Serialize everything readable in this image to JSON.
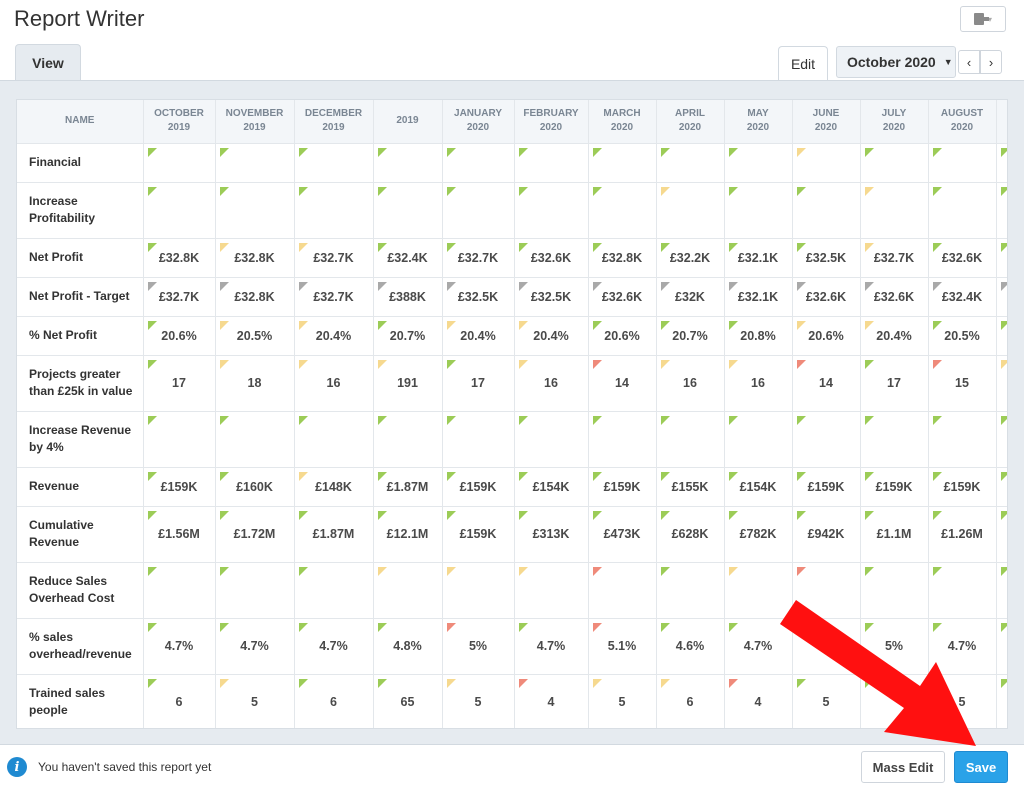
{
  "app": {
    "title": "Report Writer"
  },
  "tabs": {
    "view": "View",
    "edit": "Edit"
  },
  "period": {
    "label": "October 2020",
    "prev": "‹",
    "next": "›"
  },
  "export_button": {
    "icon": "export-document-icon",
    "caret": "▾"
  },
  "columns": [
    [
      "OCTOBER",
      "2019"
    ],
    [
      "NOVEMBER",
      "2019"
    ],
    [
      "DECEMBER",
      "2019"
    ],
    [
      "2019",
      ""
    ],
    [
      "JANUARY",
      "2020"
    ],
    [
      "FEBRUARY",
      "2020"
    ],
    [
      "MARCH",
      "2020"
    ],
    [
      "APRIL",
      "2020"
    ],
    [
      "MAY",
      "2020"
    ],
    [
      "JUNE",
      "2020"
    ],
    [
      "JULY",
      "2020"
    ],
    [
      "AUGUST",
      "2020"
    ],
    [
      "",
      ""
    ]
  ],
  "name_header": "NAME",
  "status_colors": {
    "g": "#9ccc57",
    "y": "#f6d98f",
    "r": "#ef8a7a",
    "s": "#a9a9a9"
  },
  "rows": [
    {
      "name": "Financial",
      "values": [
        "",
        "",
        "",
        "",
        "",
        "",
        "",
        "",
        "",
        "",
        "",
        "",
        ""
      ],
      "status": "gggggggggyggg"
    },
    {
      "name": "Increase Profitability",
      "values": [
        "",
        "",
        "",
        "",
        "",
        "",
        "",
        "",
        "",
        "",
        "",
        "",
        ""
      ],
      "status": "gggggggyggyggg"
    },
    {
      "name": "Net Profit",
      "values": [
        "£32.8K",
        "£32.8K",
        "£32.7K",
        "£32.4K",
        "£32.7K",
        "£32.6K",
        "£32.8K",
        "£32.2K",
        "£32.1K",
        "£32.5K",
        "£32.7K",
        "£32.6K",
        ""
      ],
      "status": "gyygggggggyggg"
    },
    {
      "name": "Net Profit - Target",
      "values": [
        "£32.7K",
        "£32.8K",
        "£32.7K",
        "£388K",
        "£32.5K",
        "£32.5K",
        "£32.6K",
        "£32K",
        "£32.1K",
        "£32.6K",
        "£32.6K",
        "£32.4K",
        ""
      ],
      "status": "sssssssssssss"
    },
    {
      "name": "% Net Profit",
      "values": [
        "20.6%",
        "20.5%",
        "20.4%",
        "20.7%",
        "20.4%",
        "20.4%",
        "20.6%",
        "20.7%",
        "20.8%",
        "20.6%",
        "20.4%",
        "20.5%",
        ""
      ],
      "status": "gyygyygggyygg"
    },
    {
      "name": "Projects greater than £25k in value",
      "values": [
        "17",
        "18",
        "16",
        "191",
        "17",
        "16",
        "14",
        "16",
        "16",
        "14",
        "17",
        "15",
        ""
      ],
      "status": "gyyygyryyrgry"
    },
    {
      "name": "Increase Revenue by 4%",
      "values": [
        "",
        "",
        "",
        "",
        "",
        "",
        "",
        "",
        "",
        "",
        "",
        "",
        ""
      ],
      "status": "ggggggggggggg"
    },
    {
      "name": "Revenue",
      "values": [
        "£159K",
        "£160K",
        "£148K",
        "£1.87M",
        "£159K",
        "£154K",
        "£159K",
        "£155K",
        "£154K",
        "£159K",
        "£159K",
        "£159K",
        ""
      ],
      "status": "ggyggggggggggg"
    },
    {
      "name": "Cumulative Revenue",
      "values": [
        "£1.56M",
        "£1.72M",
        "£1.87M",
        "£12.1M",
        "£159K",
        "£313K",
        "£473K",
        "£628K",
        "£782K",
        "£942K",
        "£1.1M",
        "£1.26M",
        ""
      ],
      "status": "ggggggggggggg"
    },
    {
      "name": "Reduce Sales Overhead Cost",
      "values": [
        "",
        "",
        "",
        "",
        "",
        "",
        "",
        "",
        "",
        "",
        "",
        "",
        ""
      ],
      "status": "gggyyyrgyrggg"
    },
    {
      "name": "% sales overhead/revenue",
      "values": [
        "4.7%",
        "4.7%",
        "4.7%",
        "4.8%",
        "5%",
        "4.7%",
        "5.1%",
        "4.6%",
        "4.7%",
        "",
        "5%",
        "4.7%",
        ""
      ],
      "status": "ggggrgrggggggg"
    },
    {
      "name": "Trained sales people",
      "values": [
        "6",
        "5",
        "6",
        "65",
        "5",
        "4",
        "5",
        "6",
        "4",
        "5",
        "",
        "5",
        ""
      ],
      "status": "gyggyryyrgggg"
    }
  ],
  "status_bar": {
    "info_icon": "info-icon",
    "message": "You haven't saved this report yet",
    "mass_edit": "Mass Edit",
    "save": "Save"
  },
  "annotation": {
    "arrow_color": "#ff1010"
  }
}
